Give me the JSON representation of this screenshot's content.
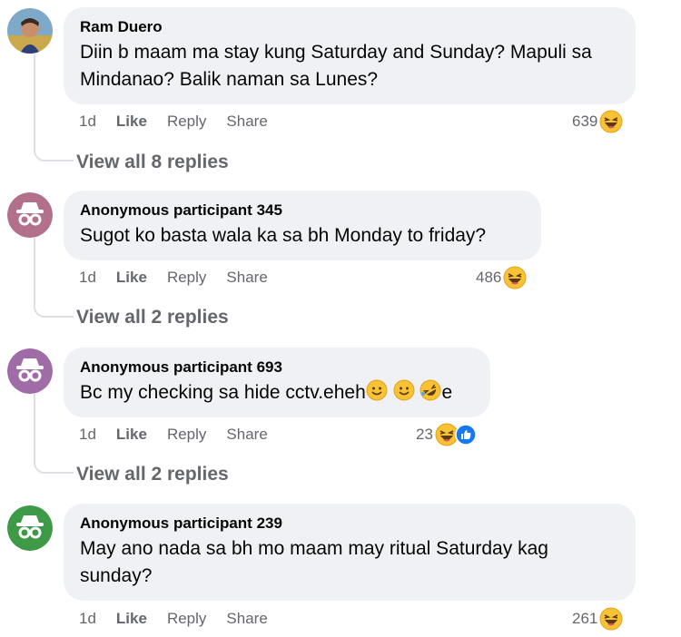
{
  "comments": [
    {
      "author": "Ram Duero",
      "text": "Diin b maam ma stay kung Saturday and Sunday? Mapuli sa Mindanao? Balik naman sa Lunes?",
      "time": "1d",
      "like": "Like",
      "reply": "Reply",
      "share": "Share",
      "reaction_count": "639",
      "reactions": [
        "haha"
      ],
      "view_replies": "View all 8 replies",
      "avatar": "profile-photo"
    },
    {
      "author": "Anonymous participant 345",
      "text": "Sugot ko basta wala ka sa bh Monday to friday?",
      "time": "1d",
      "like": "Like",
      "reply": "Reply",
      "share": "Share",
      "reaction_count": "486",
      "reactions": [
        "haha"
      ],
      "view_replies": "View all 2 replies",
      "avatar": "anonymous-icon",
      "avatar_color": "#b3708a"
    },
    {
      "author": "Anonymous participant 693",
      "text_before": "Bc my checking sa hide cctv.eheh",
      "text_after": "e",
      "inline_emojis": [
        "smile",
        "smile",
        "rofl"
      ],
      "time": "1d",
      "like": "Like",
      "reply": "Reply",
      "share": "Share",
      "reaction_count": "23",
      "reactions": [
        "haha",
        "like"
      ],
      "view_replies": "View all 2 replies",
      "avatar": "anonymous-icon",
      "avatar_color": "#a06ca8"
    },
    {
      "author": "Anonymous participant 239",
      "text": "May ano nada sa bh mo maam may ritual Saturday kag\nsunday?",
      "time": "1d",
      "like": "Like",
      "reply": "Reply",
      "share": "Share",
      "reaction_count": "261",
      "reactions": [
        "haha"
      ],
      "avatar": "anonymous-icon",
      "avatar_color": "#3f9a47"
    }
  ],
  "colors": {
    "bubble": "#eff1f4",
    "secondary_text": "#65676b",
    "like_blue": "#1877f2",
    "haha_yellow": "#f7c335"
  }
}
